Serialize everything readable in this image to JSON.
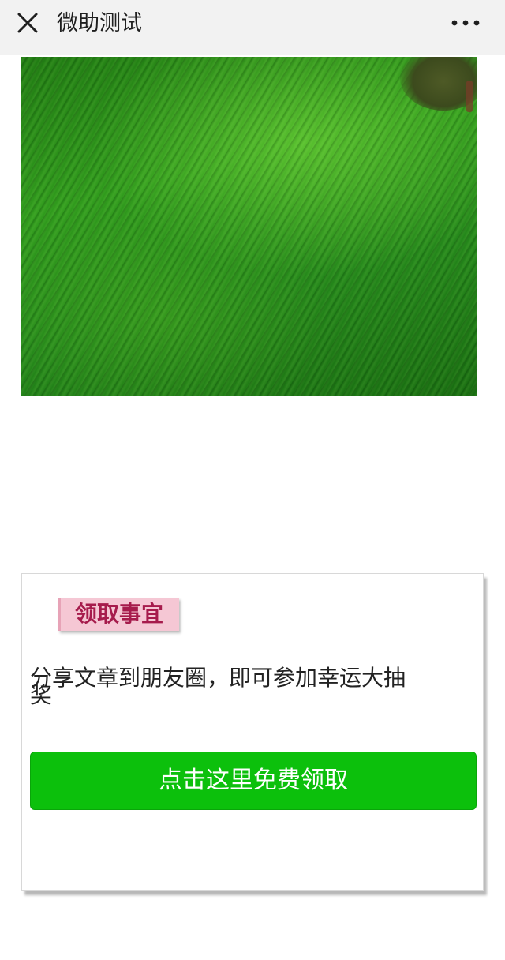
{
  "header": {
    "title": "微助测试",
    "close_icon": "close-icon",
    "more_icon": "more-icon"
  },
  "hero": {
    "image": "green-field-photo"
  },
  "card": {
    "tag_label": "领取事宜",
    "description_line1": "分享文章到朋友圈，即可参加幸运大抽",
    "description_line2": "奖",
    "cta_label": "点击这里免费领取",
    "cta_color": "#0cc00c",
    "tag_color": "#f5c7d4",
    "tag_text_color": "#a61b4c"
  }
}
